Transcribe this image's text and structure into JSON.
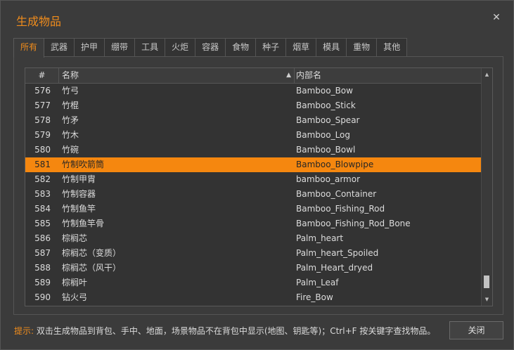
{
  "window": {
    "title": "生成物品",
    "close_glyph": "✕"
  },
  "tabs": [
    {
      "label": "所有",
      "active": true
    },
    {
      "label": "武器",
      "active": false
    },
    {
      "label": "护甲",
      "active": false
    },
    {
      "label": "绷带",
      "active": false
    },
    {
      "label": "工具",
      "active": false
    },
    {
      "label": "火炬",
      "active": false
    },
    {
      "label": "容器",
      "active": false
    },
    {
      "label": "食物",
      "active": false
    },
    {
      "label": "种子",
      "active": false
    },
    {
      "label": "烟草",
      "active": false
    },
    {
      "label": "模具",
      "active": false
    },
    {
      "label": "重物",
      "active": false
    },
    {
      "label": "其他",
      "active": false
    }
  ],
  "table": {
    "columns": {
      "num": "#",
      "name": "名称",
      "internal": "内部名"
    },
    "sort_indicator": "▲",
    "selected_num": "581",
    "rows": [
      {
        "num": "576",
        "name": "竹弓",
        "internal": "Bamboo_Bow"
      },
      {
        "num": "577",
        "name": "竹棍",
        "internal": "Bamboo_Stick"
      },
      {
        "num": "578",
        "name": "竹矛",
        "internal": "Bamboo_Spear"
      },
      {
        "num": "579",
        "name": "竹木",
        "internal": "Bamboo_Log"
      },
      {
        "num": "580",
        "name": "竹碗",
        "internal": "Bamboo_Bowl"
      },
      {
        "num": "581",
        "name": "竹制吹箭筒",
        "internal": "Bamboo_Blowpipe"
      },
      {
        "num": "582",
        "name": "竹制甲胄",
        "internal": "bamboo_armor"
      },
      {
        "num": "583",
        "name": "竹制容器",
        "internal": "Bamboo_Container"
      },
      {
        "num": "584",
        "name": "竹制鱼竿",
        "internal": "Bamboo_Fishing_Rod"
      },
      {
        "num": "585",
        "name": "竹制鱼竿骨",
        "internal": "Bamboo_Fishing_Rod_Bone"
      },
      {
        "num": "586",
        "name": "棕榈芯",
        "internal": "Palm_heart"
      },
      {
        "num": "587",
        "name": "棕榈芯（变质）",
        "internal": "Palm_heart_Spoiled"
      },
      {
        "num": "588",
        "name": "棕榈芯（风干）",
        "internal": "Palm_Heart_dryed"
      },
      {
        "num": "589",
        "name": "棕榈叶",
        "internal": "Palm_Leaf"
      },
      {
        "num": "590",
        "name": "钻火弓",
        "internal": "Fire_Bow"
      }
    ]
  },
  "scrollbar": {
    "up_glyph": "▲",
    "down_glyph": "▼",
    "position": 0.97
  },
  "footer": {
    "hint_label": "提示:",
    "hint_text": " 双击生成物品到背包、手中、地面，场景物品不在背包中显示(地图、钥匙等)；Ctrl+F 按关键字查找物品。",
    "close_label": "关闭"
  },
  "colors": {
    "accent": "#f08c1c",
    "selection": "#f5870f",
    "background": "#3b3b3b"
  }
}
